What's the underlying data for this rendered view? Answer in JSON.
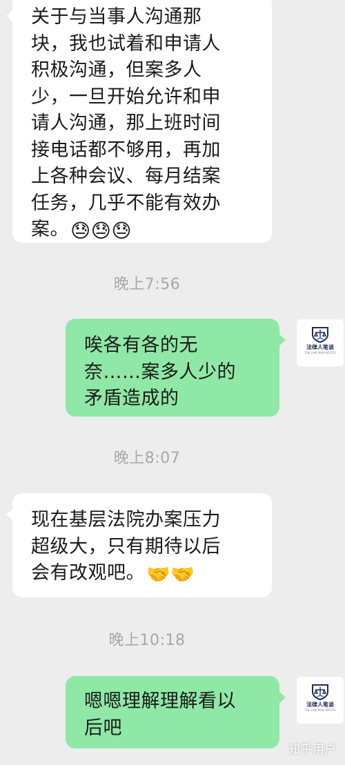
{
  "chat": {
    "messages": [
      {
        "lines": [
          "关于与当事人沟通那",
          "块，我也试着和申请人",
          "积极沟通，但案多人",
          "少，一旦开始允许和申",
          "请人沟通，那上班时间",
          "接电话都不够用，再加",
          "上各种会议、每月结案",
          "任务，几乎不能有效办",
          "案。"
        ],
        "emoji": "😓😓😓"
      },
      {
        "lines": [
          "唉各有各的无",
          "奈……案多人少的",
          "矛盾造成的"
        ]
      },
      {
        "lines": [
          "现在基层法院办案压力",
          "超级大，只有期待以后",
          "会有改观吧。"
        ],
        "emoji": "🤝🤝"
      },
      {
        "lines": [
          "嗯嗯理解理解看以",
          "后吧"
        ]
      }
    ],
    "timestamps": [
      "晚上7:56",
      "晚上8:07",
      "晚上10:18"
    ]
  },
  "avatar": {
    "name": "法律人笔谈",
    "subtitle": "THE LAW MAN WRITES",
    "icon": "shield-scale-logo",
    "color": "#1e2a5c"
  },
  "watermark": "知乎用户",
  "colors": {
    "background": "#ededed",
    "incoming_bubble": "#ffffff",
    "outgoing_bubble": "#8fe8a6",
    "timestamp": "#a7a7a7"
  }
}
